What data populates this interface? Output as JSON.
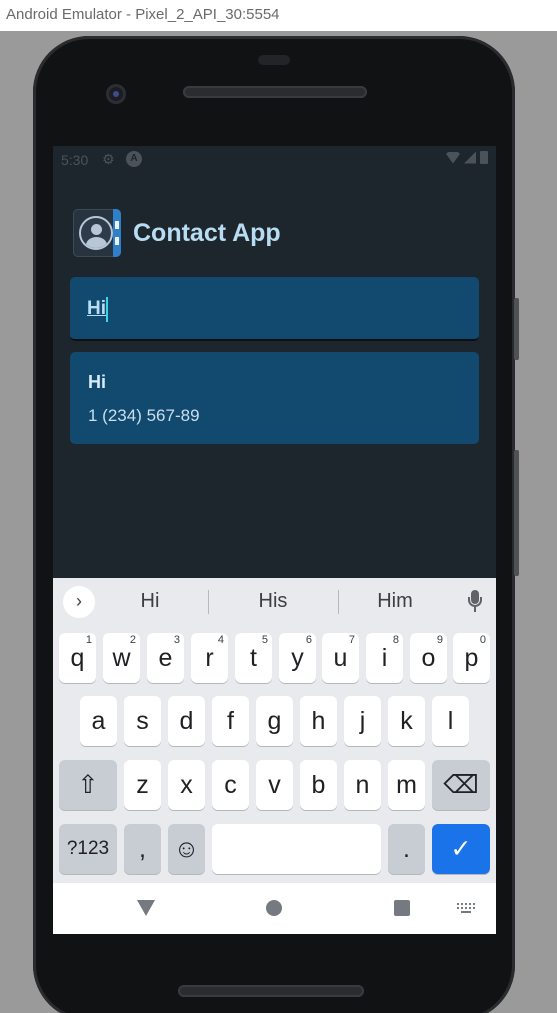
{
  "window": {
    "title": "Android Emulator - Pixel_2_API_30:5554"
  },
  "status_bar": {
    "time": "5:30",
    "gear_icon": "gear-icon",
    "notification_icon": "A"
  },
  "app": {
    "title": "Contact App"
  },
  "search": {
    "value": "Hi"
  },
  "contacts": [
    {
      "name": "Hi",
      "phone": "1 (234) 567-89"
    }
  ],
  "keyboard": {
    "suggestions": [
      "Hi",
      "His",
      "Him"
    ],
    "row1": [
      {
        "key": "q",
        "hint": "1"
      },
      {
        "key": "w",
        "hint": "2"
      },
      {
        "key": "e",
        "hint": "3"
      },
      {
        "key": "r",
        "hint": "4"
      },
      {
        "key": "t",
        "hint": "5"
      },
      {
        "key": "y",
        "hint": "6"
      },
      {
        "key": "u",
        "hint": "7"
      },
      {
        "key": "i",
        "hint": "8"
      },
      {
        "key": "o",
        "hint": "9"
      },
      {
        "key": "p",
        "hint": "0"
      }
    ],
    "row2": [
      "a",
      "s",
      "d",
      "f",
      "g",
      "h",
      "j",
      "k",
      "l"
    ],
    "row3": [
      "z",
      "x",
      "c",
      "v",
      "b",
      "n",
      "m"
    ],
    "symbols_label": "?123",
    "comma": ",",
    "period": ".",
    "shift_glyph": "⇧",
    "backspace_glyph": "⌫",
    "emoji_glyph": "☺",
    "done_glyph": "✓",
    "toggle_glyph": "›"
  }
}
